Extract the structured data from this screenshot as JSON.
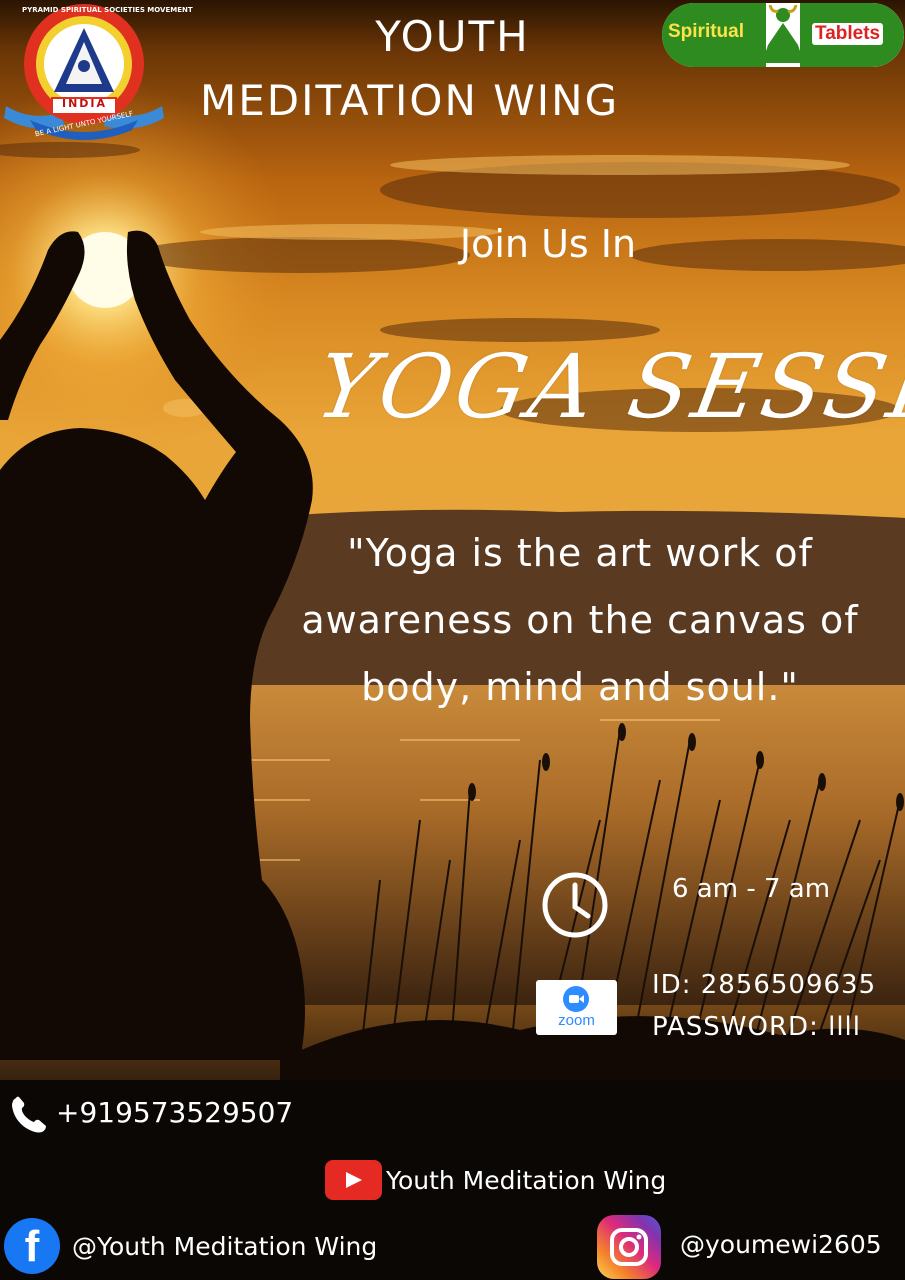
{
  "header": {
    "title_line1": "YOUTH",
    "title_line2": "MEDITATION WING"
  },
  "logo": {
    "arc_text": "PYRAMID SPIRITUAL SOCIETIES MOVEMENT",
    "country": "INDIA",
    "motto": "BE A LIGHT UNTO YOURSELF"
  },
  "badge": {
    "word1": "Spiritual",
    "word2": "Tablets",
    "colors": {
      "green": "#2e8b1f",
      "yellow": "#fde34a",
      "red": "#dd2222"
    }
  },
  "headline": {
    "invite": "Join Us In",
    "event": "YOGA SESSION"
  },
  "quote": "\"Yoga is the art work of awareness on the canvas of body, mind and soul.\"",
  "schedule": {
    "icon": "clock-icon",
    "time": "6 am - 7 am"
  },
  "zoom": {
    "icon": "zoom-logo",
    "logo_text": "zoom",
    "id": "ID: 2856509635",
    "password": "PASSWORD: llll"
  },
  "contact": {
    "phone_icon": "phone-icon",
    "phone": "+919573529507"
  },
  "social": {
    "youtube": {
      "icon": "youtube-icon",
      "label": "Youth Meditation Wing"
    },
    "facebook": {
      "icon": "facebook-icon",
      "label": "@Youth Meditation Wing"
    },
    "instagram": {
      "icon": "instagram-icon",
      "label": "@youmewi2605"
    }
  },
  "colors": {
    "sky_orange": "#e9a538",
    "sun": "#fff6c8",
    "silhouette": "#120904",
    "youtube_red": "#e52a24",
    "facebook_blue": "#1877f2",
    "zoom_blue": "#2d8cff"
  }
}
